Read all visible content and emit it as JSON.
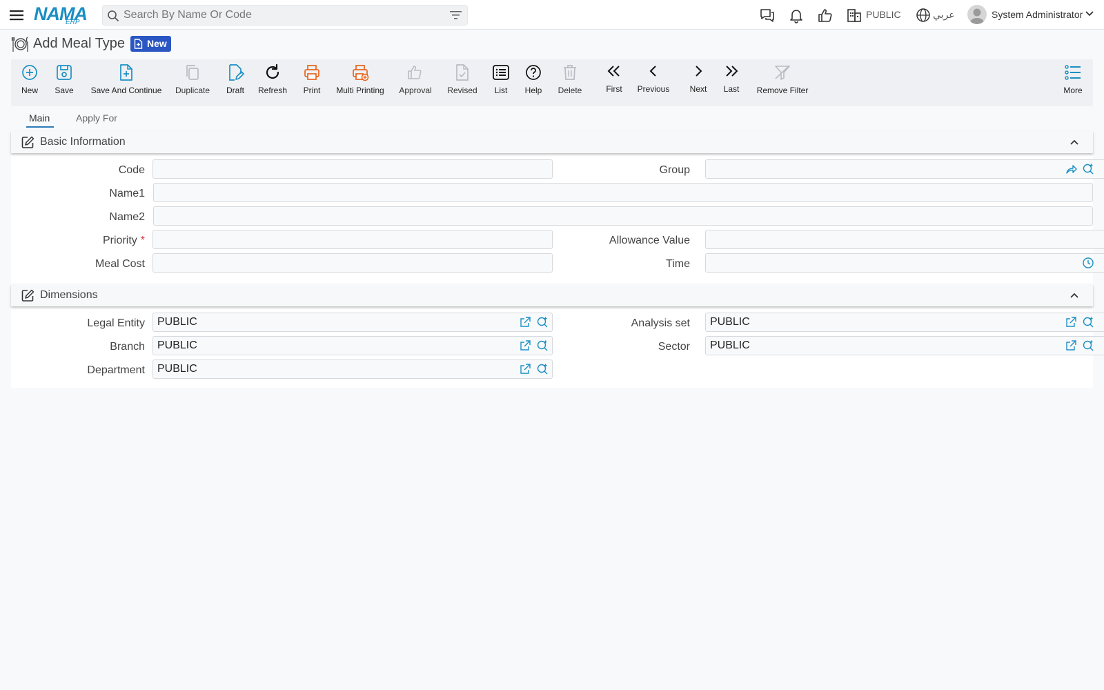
{
  "topbar": {
    "logo_text": "NAMA",
    "logo_sub": "ERP",
    "search_placeholder": "Search By Name Or Code",
    "entity": "PUBLIC",
    "language": "عربي",
    "user_name": "System Administrator"
  },
  "page": {
    "title": "Add Meal Type",
    "status_badge": "New"
  },
  "toolbar": {
    "new": "New",
    "save": "Save",
    "save_continue": "Save And Continue",
    "duplicate": "Duplicate",
    "draft": "Draft",
    "refresh": "Refresh",
    "print": "Print",
    "multi_printing": "Multi Printing",
    "approval": "Approval",
    "revised": "Revised",
    "list": "List",
    "help": "Help",
    "delete": "Delete",
    "first": "First",
    "previous": "Previous",
    "next": "Next",
    "last": "Last",
    "remove_filter": "Remove Filter",
    "more": "More"
  },
  "tabs": {
    "main": "Main",
    "apply_for": "Apply For"
  },
  "basic_info": {
    "title": "Basic Information",
    "code_label": "Code",
    "code_value": "",
    "group_label": "Group",
    "group_value": "",
    "name1_label": "Name1",
    "name1_value": "",
    "name2_label": "Name2",
    "name2_value": "",
    "priority_label": "Priority",
    "priority_value": "",
    "allowance_label": "Allowance Value",
    "allowance_value": "",
    "meal_cost_label": "Meal Cost",
    "meal_cost_value": "",
    "time_label": "Time",
    "time_value": ""
  },
  "dimensions": {
    "title": "Dimensions",
    "legal_entity_label": "Legal Entity",
    "legal_entity_value": "PUBLIC",
    "analysis_set_label": "Analysis set",
    "analysis_set_value": "PUBLIC",
    "branch_label": "Branch",
    "branch_value": "PUBLIC",
    "sector_label": "Sector",
    "sector_value": "PUBLIC",
    "department_label": "Department",
    "department_value": "PUBLIC"
  },
  "colors": {
    "brand": "#1b8fc4",
    "badge": "#2956c2",
    "orange": "#e8641c",
    "required": "#d9373a",
    "link_icon": "#1b8fc4"
  }
}
